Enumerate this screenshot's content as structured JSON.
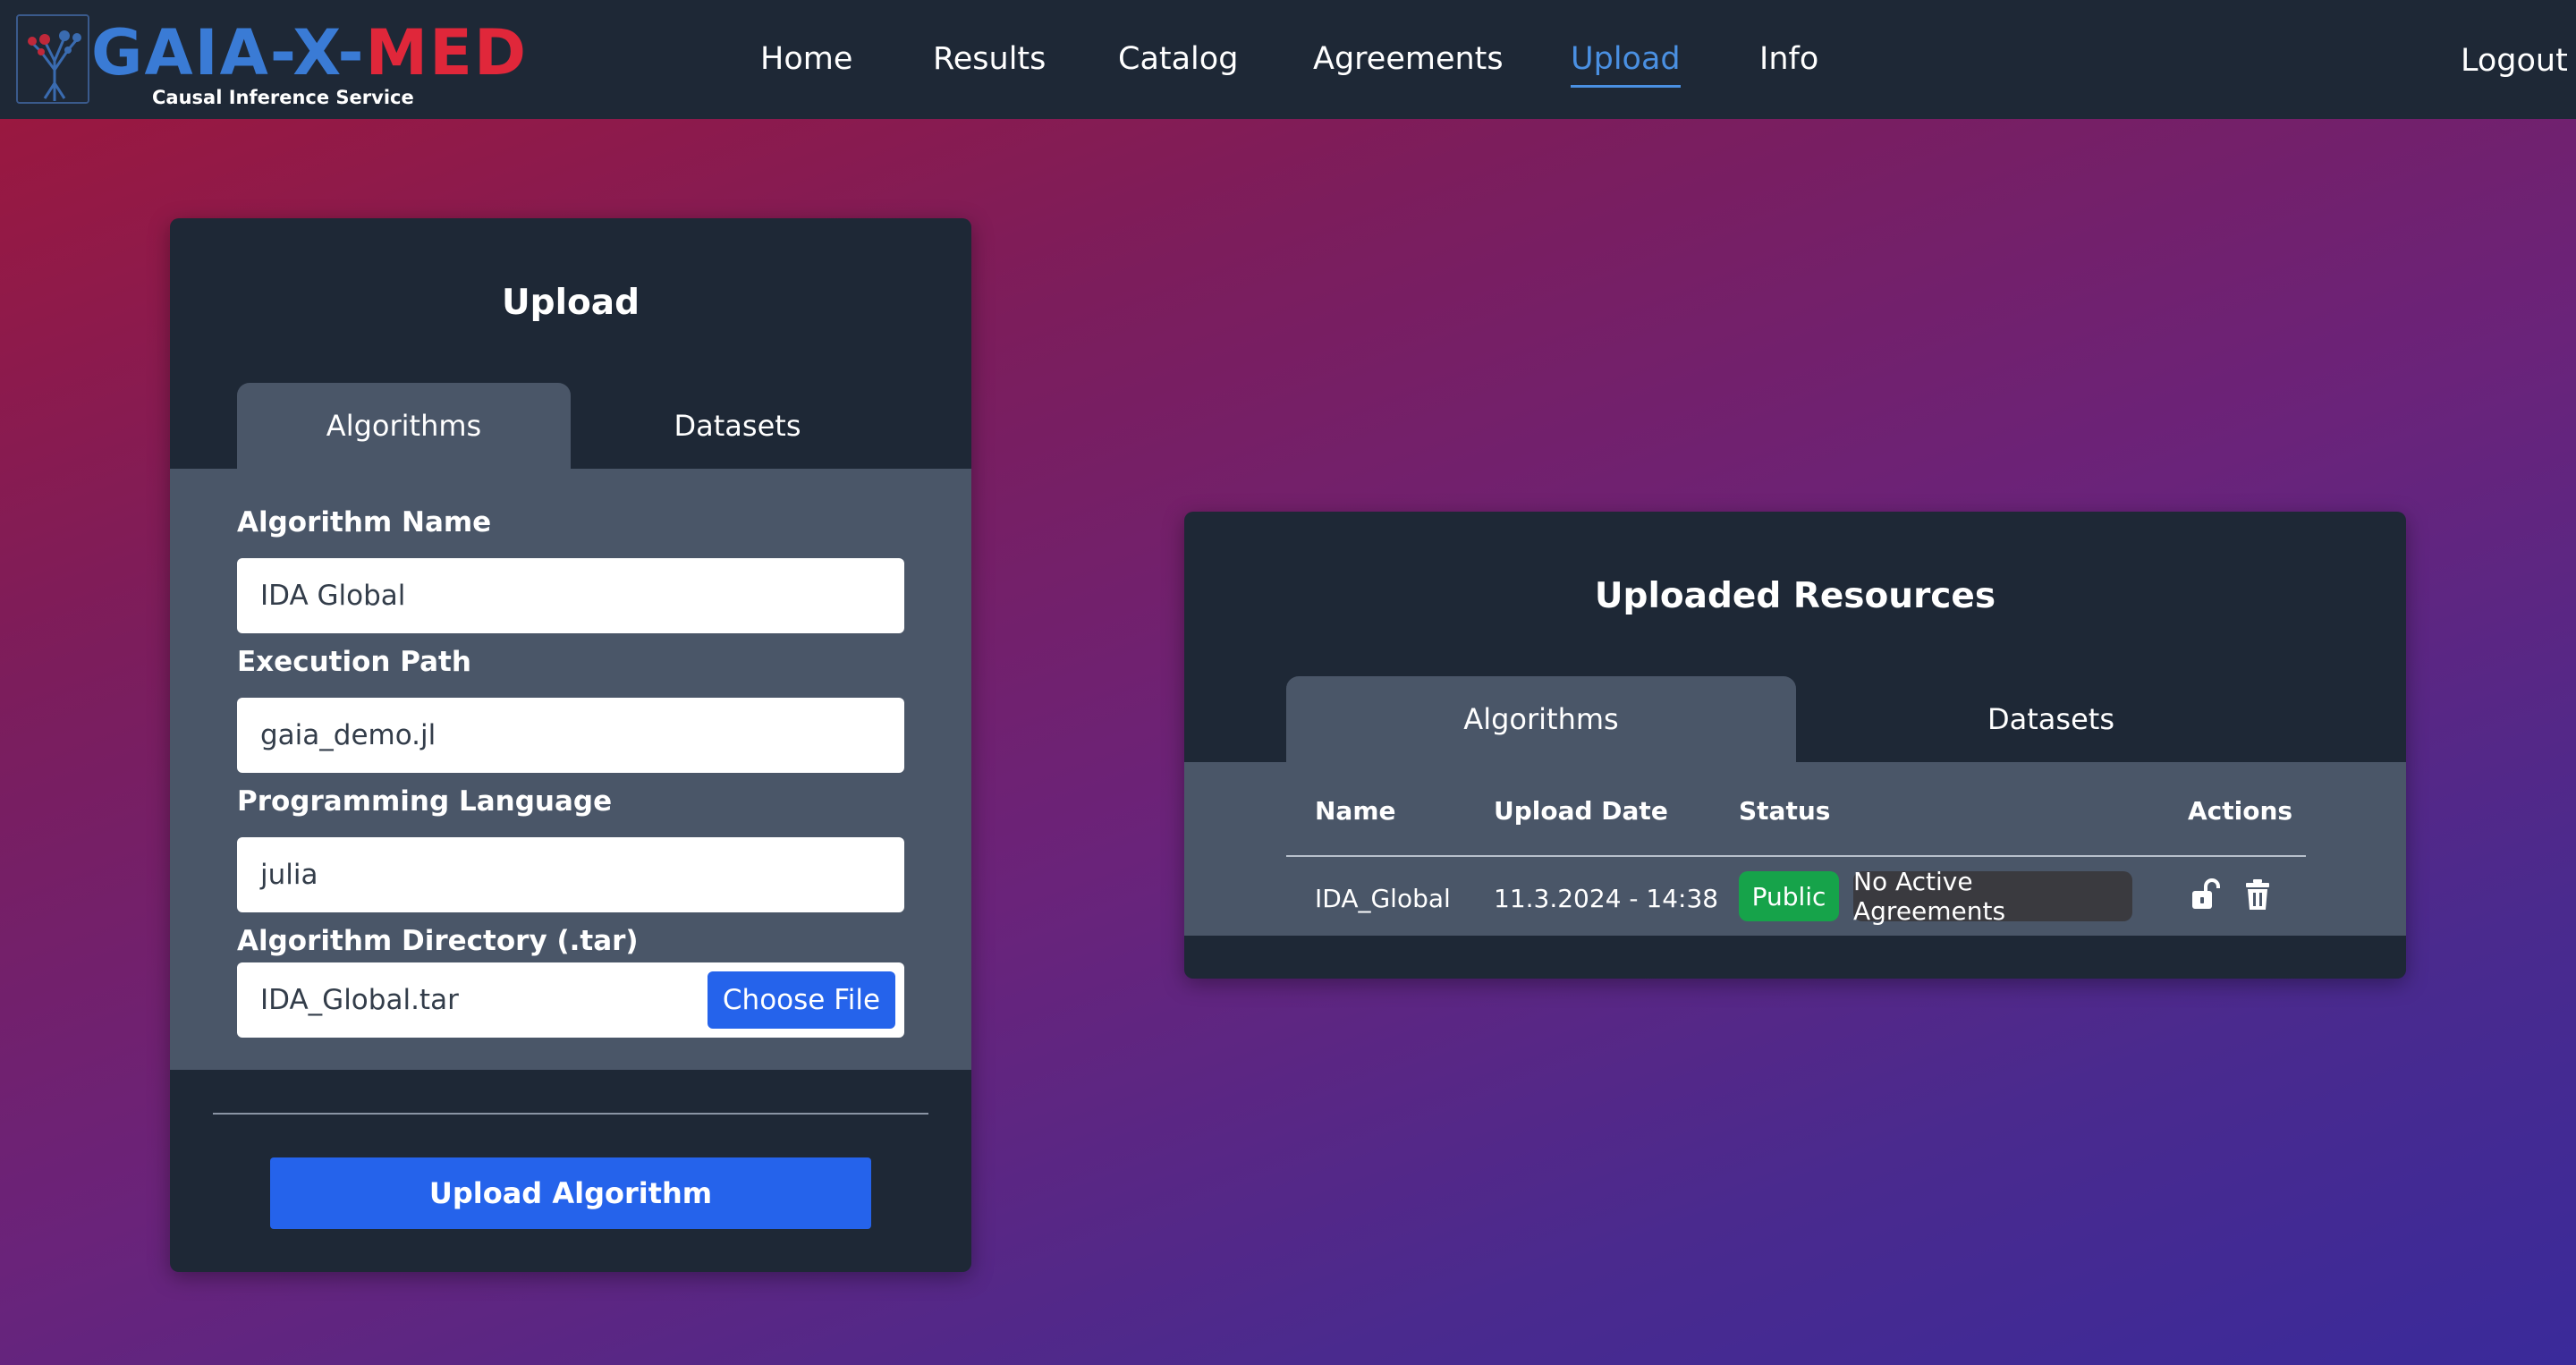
{
  "nav": {
    "logo": {
      "part1": "GAIA-X-",
      "part2": "MED",
      "subtitle": "Causal Inference Service"
    },
    "items": [
      {
        "label": "Home"
      },
      {
        "label": "Results"
      },
      {
        "label": "Catalog"
      },
      {
        "label": "Agreements"
      },
      {
        "label": "Upload",
        "active": true
      },
      {
        "label": "Info"
      }
    ],
    "logout_label": "Logout"
  },
  "upload_card": {
    "title": "Upload",
    "tabs": [
      {
        "label": "Algorithms",
        "active": true
      },
      {
        "label": "Datasets"
      }
    ],
    "fields": {
      "name": {
        "label": "Algorithm Name",
        "value": "IDA Global"
      },
      "path": {
        "label": "Execution Path",
        "value": "gaia_demo.jl"
      },
      "language": {
        "label": "Programming Language",
        "value": "julia"
      },
      "directory": {
        "label": "Algorithm Directory (.tar)",
        "value": "IDA_Global.tar",
        "button": "Choose File"
      }
    },
    "submit_label": "Upload Algorithm"
  },
  "resources_card": {
    "title": "Uploaded Resources",
    "tabs": [
      {
        "label": "Algorithms",
        "active": true
      },
      {
        "label": "Datasets"
      }
    ],
    "columns": [
      "Name",
      "Upload Date",
      "Status",
      "Actions"
    ],
    "rows": [
      {
        "name": "IDA_Global",
        "date": "11.3.2024 - 14:38",
        "status": "Public",
        "agreements": "No Active Agreements"
      }
    ]
  },
  "colors": {
    "accent": "#2563eb",
    "active_nav": "#4a90e2",
    "public_badge": "#16a34a",
    "card_bg": "#1e2836",
    "panel_bg": "#4a5668"
  },
  "icons": [
    "tree-logo-icon",
    "unlock-icon",
    "trash-icon"
  ]
}
